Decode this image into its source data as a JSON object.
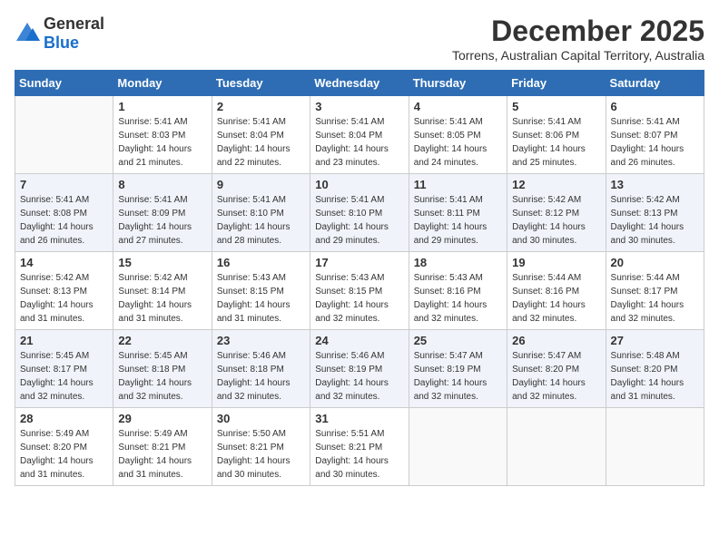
{
  "logo": {
    "general": "General",
    "blue": "Blue"
  },
  "header": {
    "month": "December 2025",
    "location": "Torrens, Australian Capital Territory, Australia"
  },
  "days_of_week": [
    "Sunday",
    "Monday",
    "Tuesday",
    "Wednesday",
    "Thursday",
    "Friday",
    "Saturday"
  ],
  "weeks": [
    [
      {
        "day": "",
        "info": ""
      },
      {
        "day": "1",
        "info": "Sunrise: 5:41 AM\nSunset: 8:03 PM\nDaylight: 14 hours\nand 21 minutes."
      },
      {
        "day": "2",
        "info": "Sunrise: 5:41 AM\nSunset: 8:04 PM\nDaylight: 14 hours\nand 22 minutes."
      },
      {
        "day": "3",
        "info": "Sunrise: 5:41 AM\nSunset: 8:04 PM\nDaylight: 14 hours\nand 23 minutes."
      },
      {
        "day": "4",
        "info": "Sunrise: 5:41 AM\nSunset: 8:05 PM\nDaylight: 14 hours\nand 24 minutes."
      },
      {
        "day": "5",
        "info": "Sunrise: 5:41 AM\nSunset: 8:06 PM\nDaylight: 14 hours\nand 25 minutes."
      },
      {
        "day": "6",
        "info": "Sunrise: 5:41 AM\nSunset: 8:07 PM\nDaylight: 14 hours\nand 26 minutes."
      }
    ],
    [
      {
        "day": "7",
        "info": "Sunrise: 5:41 AM\nSunset: 8:08 PM\nDaylight: 14 hours\nand 26 minutes."
      },
      {
        "day": "8",
        "info": "Sunrise: 5:41 AM\nSunset: 8:09 PM\nDaylight: 14 hours\nand 27 minutes."
      },
      {
        "day": "9",
        "info": "Sunrise: 5:41 AM\nSunset: 8:10 PM\nDaylight: 14 hours\nand 28 minutes."
      },
      {
        "day": "10",
        "info": "Sunrise: 5:41 AM\nSunset: 8:10 PM\nDaylight: 14 hours\nand 29 minutes."
      },
      {
        "day": "11",
        "info": "Sunrise: 5:41 AM\nSunset: 8:11 PM\nDaylight: 14 hours\nand 29 minutes."
      },
      {
        "day": "12",
        "info": "Sunrise: 5:42 AM\nSunset: 8:12 PM\nDaylight: 14 hours\nand 30 minutes."
      },
      {
        "day": "13",
        "info": "Sunrise: 5:42 AM\nSunset: 8:13 PM\nDaylight: 14 hours\nand 30 minutes."
      }
    ],
    [
      {
        "day": "14",
        "info": "Sunrise: 5:42 AM\nSunset: 8:13 PM\nDaylight: 14 hours\nand 31 minutes."
      },
      {
        "day": "15",
        "info": "Sunrise: 5:42 AM\nSunset: 8:14 PM\nDaylight: 14 hours\nand 31 minutes."
      },
      {
        "day": "16",
        "info": "Sunrise: 5:43 AM\nSunset: 8:15 PM\nDaylight: 14 hours\nand 31 minutes."
      },
      {
        "day": "17",
        "info": "Sunrise: 5:43 AM\nSunset: 8:15 PM\nDaylight: 14 hours\nand 32 minutes."
      },
      {
        "day": "18",
        "info": "Sunrise: 5:43 AM\nSunset: 8:16 PM\nDaylight: 14 hours\nand 32 minutes."
      },
      {
        "day": "19",
        "info": "Sunrise: 5:44 AM\nSunset: 8:16 PM\nDaylight: 14 hours\nand 32 minutes."
      },
      {
        "day": "20",
        "info": "Sunrise: 5:44 AM\nSunset: 8:17 PM\nDaylight: 14 hours\nand 32 minutes."
      }
    ],
    [
      {
        "day": "21",
        "info": "Sunrise: 5:45 AM\nSunset: 8:17 PM\nDaylight: 14 hours\nand 32 minutes."
      },
      {
        "day": "22",
        "info": "Sunrise: 5:45 AM\nSunset: 8:18 PM\nDaylight: 14 hours\nand 32 minutes."
      },
      {
        "day": "23",
        "info": "Sunrise: 5:46 AM\nSunset: 8:18 PM\nDaylight: 14 hours\nand 32 minutes."
      },
      {
        "day": "24",
        "info": "Sunrise: 5:46 AM\nSunset: 8:19 PM\nDaylight: 14 hours\nand 32 minutes."
      },
      {
        "day": "25",
        "info": "Sunrise: 5:47 AM\nSunset: 8:19 PM\nDaylight: 14 hours\nand 32 minutes."
      },
      {
        "day": "26",
        "info": "Sunrise: 5:47 AM\nSunset: 8:20 PM\nDaylight: 14 hours\nand 32 minutes."
      },
      {
        "day": "27",
        "info": "Sunrise: 5:48 AM\nSunset: 8:20 PM\nDaylight: 14 hours\nand 31 minutes."
      }
    ],
    [
      {
        "day": "28",
        "info": "Sunrise: 5:49 AM\nSunset: 8:20 PM\nDaylight: 14 hours\nand 31 minutes."
      },
      {
        "day": "29",
        "info": "Sunrise: 5:49 AM\nSunset: 8:21 PM\nDaylight: 14 hours\nand 31 minutes."
      },
      {
        "day": "30",
        "info": "Sunrise: 5:50 AM\nSunset: 8:21 PM\nDaylight: 14 hours\nand 30 minutes."
      },
      {
        "day": "31",
        "info": "Sunrise: 5:51 AM\nSunset: 8:21 PM\nDaylight: 14 hours\nand 30 minutes."
      },
      {
        "day": "",
        "info": ""
      },
      {
        "day": "",
        "info": ""
      },
      {
        "day": "",
        "info": ""
      }
    ]
  ]
}
